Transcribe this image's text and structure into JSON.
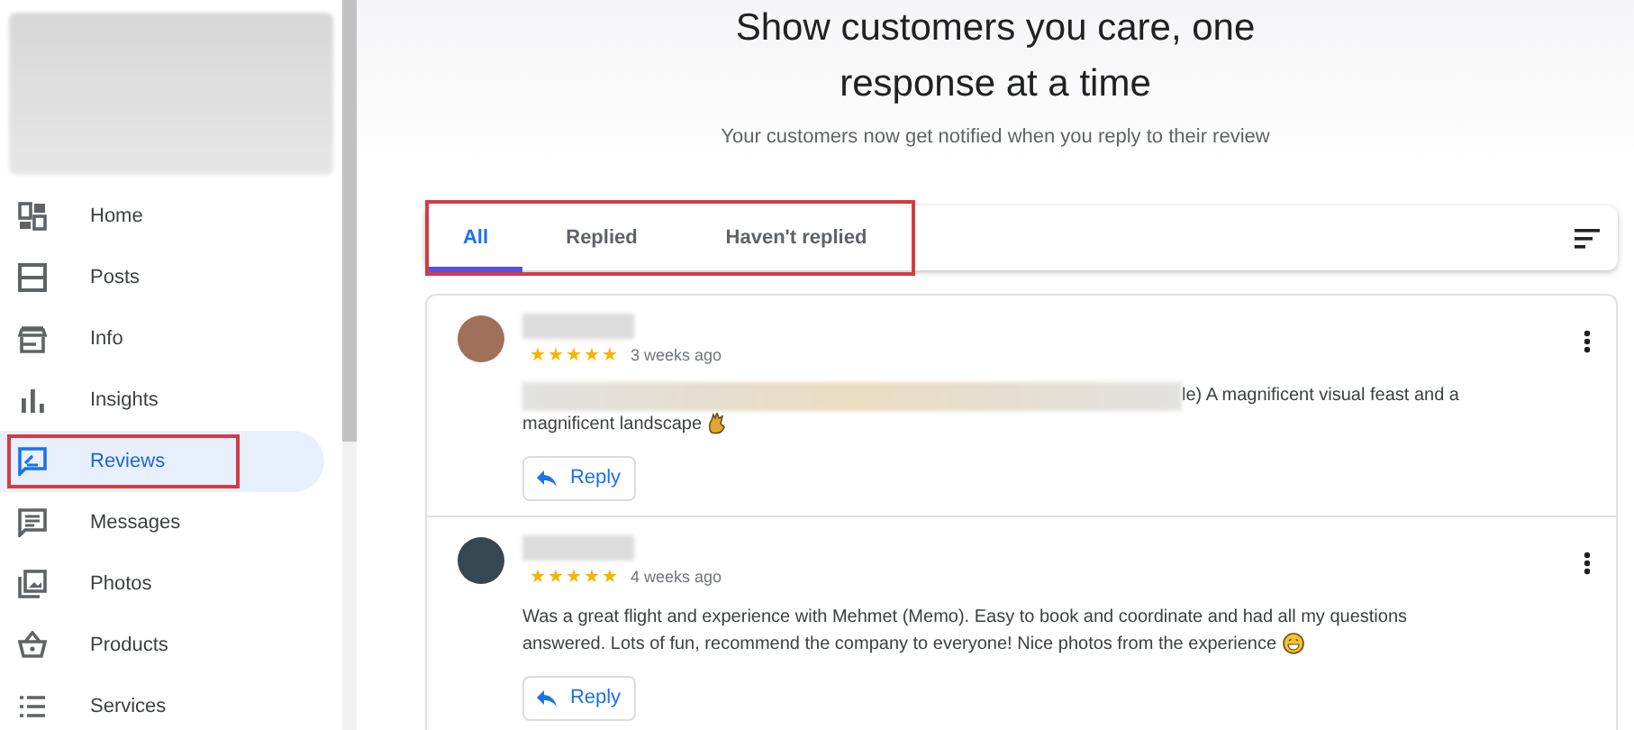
{
  "sidebar": {
    "items": [
      {
        "label": "Home",
        "selected": false
      },
      {
        "label": "Posts",
        "selected": false
      },
      {
        "label": "Info",
        "selected": false
      },
      {
        "label": "Insights",
        "selected": false
      },
      {
        "label": "Reviews",
        "selected": true
      },
      {
        "label": "Messages",
        "selected": false
      },
      {
        "label": "Photos",
        "selected": false
      },
      {
        "label": "Products",
        "selected": false
      },
      {
        "label": "Services",
        "selected": false
      }
    ]
  },
  "header": {
    "title": "Show customers you care, one response at a time",
    "subtitle": "Your customers now get notified when you reply to their review"
  },
  "tabs": [
    {
      "label": "All",
      "selected": true
    },
    {
      "label": "Replied",
      "selected": false
    },
    {
      "label": "Haven't replied",
      "selected": false
    }
  ],
  "reviews": [
    {
      "kind": "partly_blurred",
      "stars": 5,
      "time": "3 weeks ago",
      "lines": [
        "le) A magnificent visual feast and a",
        "magnificent landscape"
      ],
      "reply": "Reply"
    },
    {
      "kind": "plain",
      "stars": 5,
      "time": "4 weeks ago",
      "lines": [
        "Was a great flight and experience with Mehmet (Memo). Easy to book and coordinate and had all my questions",
        "answered. Lots of fun, recommend the company to everyone! Nice photos from the experience"
      ],
      "reply": "Reply"
    }
  ]
}
